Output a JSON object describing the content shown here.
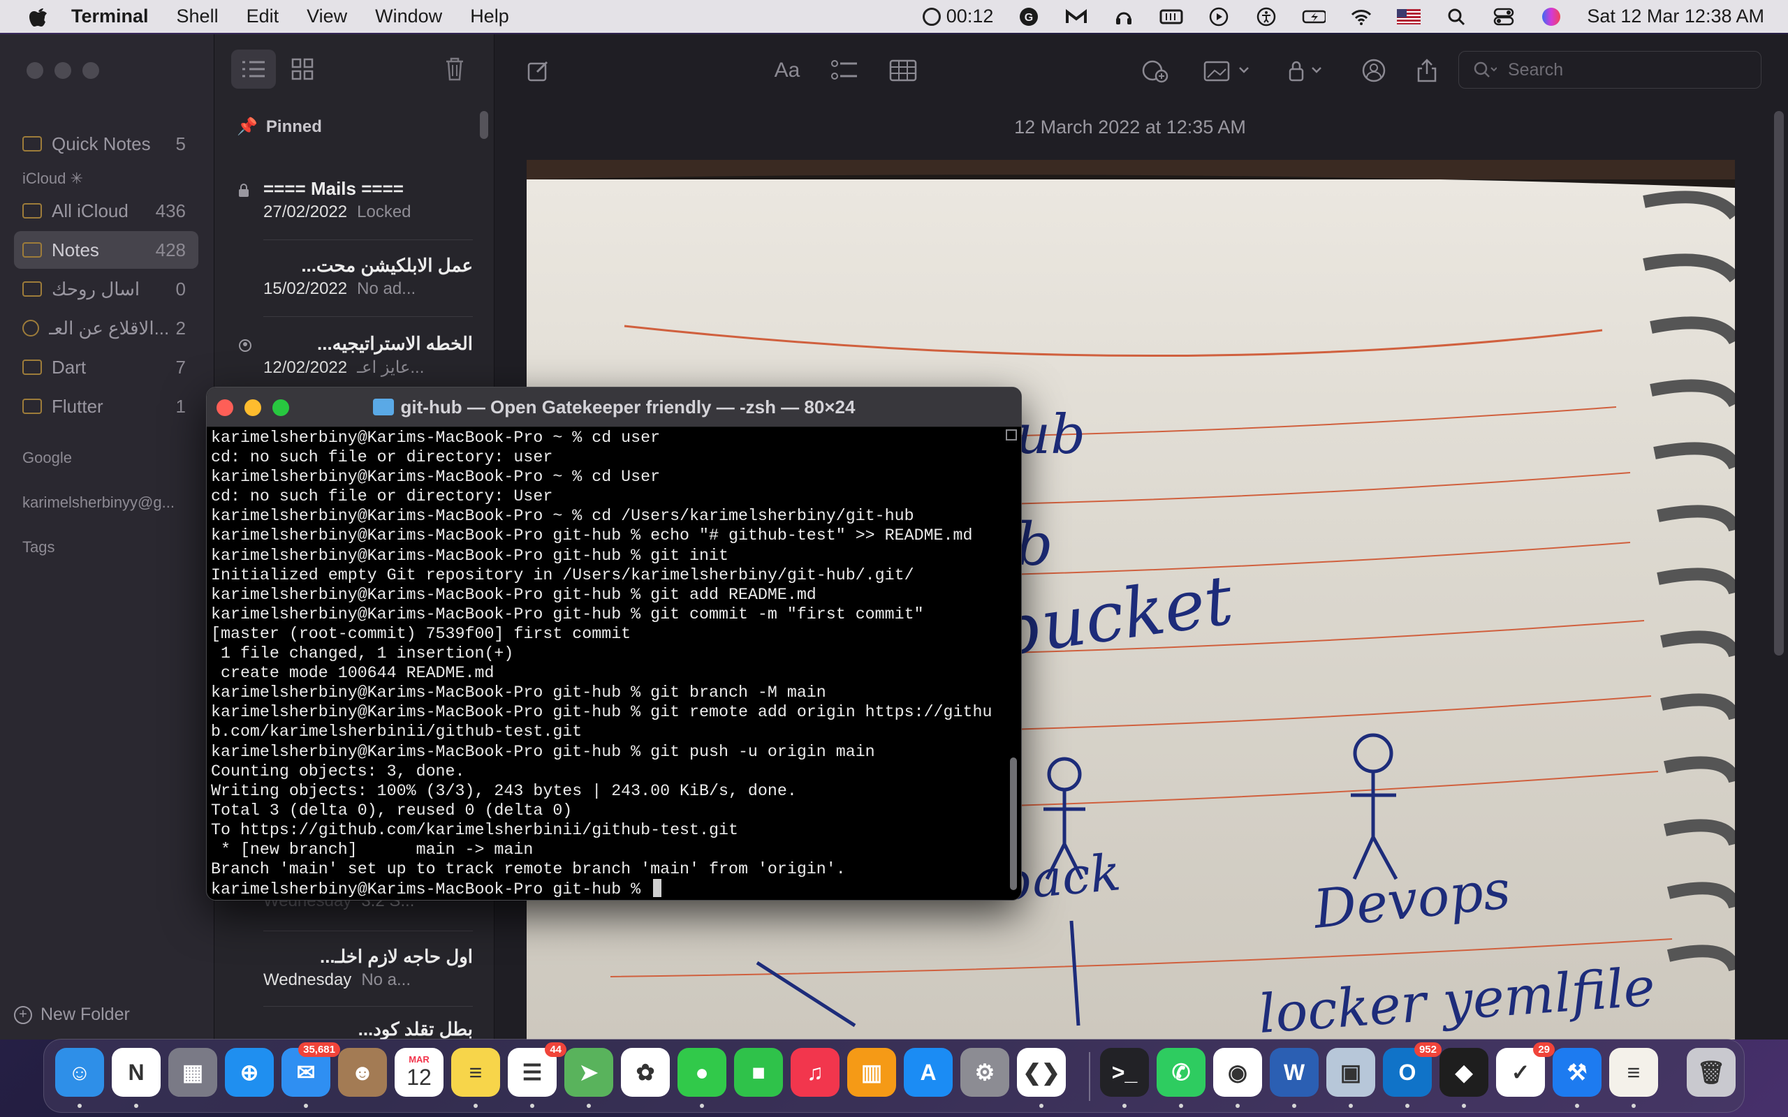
{
  "menubar": {
    "app": "Terminal",
    "items": [
      "Shell",
      "Edit",
      "View",
      "Window",
      "Help"
    ],
    "timer": "00:12",
    "clock": "Sat 12 Mar  12:38 AM"
  },
  "notes": {
    "sidebar": {
      "quick_notes": {
        "label": "Quick Notes",
        "count": "5"
      },
      "icloud_header": "iCloud",
      "folders": [
        {
          "label": "All iCloud",
          "count": "436"
        },
        {
          "label": "Notes",
          "count": "428"
        },
        {
          "label": "اسال روحك",
          "count": "0"
        },
        {
          "label": "الاقلاع عن العـ...",
          "count": "2"
        },
        {
          "label": "Dart",
          "count": "7"
        },
        {
          "label": "Flutter",
          "count": "1"
        }
      ],
      "google_header": "Google",
      "account": "karimelsherbinyy@g...",
      "tags": "Tags",
      "new_folder": "New Folder"
    },
    "list": {
      "pinned": "Pinned",
      "items": [
        {
          "title": "==== Mails ====",
          "date": "27/02/2022",
          "preview": "Locked"
        },
        {
          "title": "عمل الابلكيشن محت...",
          "date": "15/02/2022",
          "preview": "No ad..."
        },
        {
          "title": "الخطه الاستراتيجيه...",
          "date": "12/02/2022",
          "preview": "عايز اعـ..."
        },
        {
          "title": "",
          "date": "Wednesday",
          "preview": "3.2 S..."
        },
        {
          "title": "اول حاجه لازم اخلـ...",
          "date": "Wednesday",
          "preview": "No a..."
        },
        {
          "title": "بطل تقلد كود...",
          "date": "",
          "preview": ""
        }
      ]
    },
    "editor": {
      "date": "12 March 2022 at 12:35 AM",
      "search_placeholder": "Search",
      "font_label": "Aa"
    }
  },
  "terminal": {
    "title": "git-hub — Open Gatekeeper friendly — -zsh — 80×24",
    "lines": [
      "karimelsherbiny@Karims-MacBook-Pro ~ % cd user",
      "cd: no such file or directory: user",
      "karimelsherbiny@Karims-MacBook-Pro ~ % cd User",
      "cd: no such file or directory: User",
      "karimelsherbiny@Karims-MacBook-Pro ~ % cd /Users/karimelsherbiny/git-hub",
      "karimelsherbiny@Karims-MacBook-Pro git-hub % echo \"# github-test\" >> README.md",
      "karimelsherbiny@Karims-MacBook-Pro git-hub % git init",
      "Initialized empty Git repository in /Users/karimelsherbiny/git-hub/.git/",
      "karimelsherbiny@Karims-MacBook-Pro git-hub % git add README.md",
      "karimelsherbiny@Karims-MacBook-Pro git-hub % git commit -m \"first commit\"",
      "[master (root-commit) 7539f00] first commit",
      " 1 file changed, 1 insertion(+)",
      " create mode 100644 README.md",
      "karimelsherbiny@Karims-MacBook-Pro git-hub % git branch -M main",
      "karimelsherbiny@Karims-MacBook-Pro git-hub % git remote add origin https://githu",
      "b.com/karimelsherbinii/github-test.git",
      "karimelsherbiny@Karims-MacBook-Pro git-hub % git push -u origin main",
      "Counting objects: 3, done.",
      "Writing objects: 100% (3/3), 243 bytes | 243.00 KiB/s, done.",
      "Total 3 (delta 0), reused 0 (delta 0)",
      "To https://github.com/karimelsherbinii/github-test.git",
      " * [new branch]      main -> main",
      "Branch 'main' set up to track remote branch 'main' from 'origin'.",
      "karimelsherbiny@Karims-MacBook-Pro git-hub % "
    ]
  },
  "photo": {
    "handwriting": [
      "ub",
      "b",
      "bucket",
      "back",
      "Devops",
      "locker yemlfile"
    ]
  },
  "dock": {
    "apps": [
      {
        "name": "Finder",
        "color": "#2e8fe8",
        "glyph": "☺"
      },
      {
        "name": "Notion",
        "color": "#ffffff",
        "glyph": "N"
      },
      {
        "name": "Launchpad",
        "color": "#7a7a86",
        "glyph": "▦"
      },
      {
        "name": "Safari",
        "color": "#1f8ff0",
        "glyph": "⊕"
      },
      {
        "name": "Mail",
        "color": "#2f8ff2",
        "glyph": "✉",
        "badge": "35,681"
      },
      {
        "name": "Contacts",
        "color": "#a37b54",
        "glyph": "☻"
      },
      {
        "name": "Calendar",
        "color": "#ffffff",
        "glyph": "12",
        "month": "MAR"
      },
      {
        "name": "Notes",
        "color": "#f7d54a",
        "glyph": "≡"
      },
      {
        "name": "Reminders",
        "color": "#ffffff",
        "glyph": "☰",
        "badge": "44"
      },
      {
        "name": "Maps",
        "color": "#59b35c",
        "glyph": "➤"
      },
      {
        "name": "Photos",
        "color": "#ffffff",
        "glyph": "✿"
      },
      {
        "name": "Messages",
        "color": "#31c94a",
        "glyph": "●"
      },
      {
        "name": "FaceTime",
        "color": "#2fc24a",
        "glyph": "■"
      },
      {
        "name": "Music",
        "color": "#f2364d",
        "glyph": "♫"
      },
      {
        "name": "Books",
        "color": "#f59a16",
        "glyph": "▥"
      },
      {
        "name": "App Store",
        "color": "#1b8cf4",
        "glyph": "A"
      },
      {
        "name": "System Preferences",
        "color": "#8c8c93",
        "glyph": "⚙"
      },
      {
        "name": "VS Code",
        "color": "#ffffff",
        "glyph": "❮❯"
      },
      {
        "name": "Terminal",
        "color": "#222226",
        "glyph": ">_"
      },
      {
        "name": "WhatsApp",
        "color": "#2ecc60",
        "glyph": "✆"
      },
      {
        "name": "Chrome",
        "color": "#ffffff",
        "glyph": "◉"
      },
      {
        "name": "Word",
        "color": "#2b5fb3",
        "glyph": "W"
      },
      {
        "name": "Preview",
        "color": "#b7c7d9",
        "glyph": "▣"
      },
      {
        "name": "Outlook",
        "color": "#1073c8",
        "glyph": "O",
        "badge": "952"
      },
      {
        "name": "Figma",
        "color": "#1e1e1e",
        "glyph": "◆"
      },
      {
        "name": "Tasks",
        "color": "#ffffff",
        "glyph": "✓",
        "badge": "29"
      },
      {
        "name": "Xcode",
        "color": "#1d7bf0",
        "glyph": "⚒"
      },
      {
        "name": "Notes Window",
        "color": "#f4f1ea",
        "glyph": "≡"
      },
      {
        "name": "Trash",
        "color": "#c9c9cf",
        "glyph": "🗑"
      }
    ]
  }
}
